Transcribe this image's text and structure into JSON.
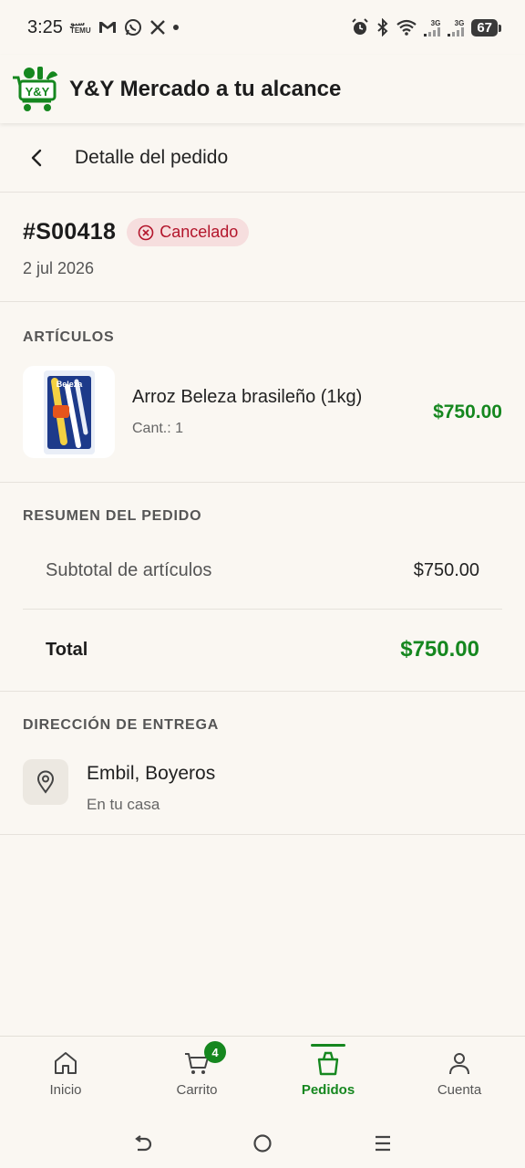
{
  "status_bar": {
    "time": "3:25",
    "mini_label_top": "ﺳﺒﻮ",
    "mini_label_bottom": "TEMU",
    "net_top": "3G",
    "net_top2": "3G",
    "battery": "67"
  },
  "app": {
    "title": "Y&Y Mercado a tu alcance",
    "logo_text": "Y&Y"
  },
  "page": {
    "title": "Detalle del pedido"
  },
  "order": {
    "id": "#S00418",
    "status": "Cancelado",
    "date": "2 jul 2026"
  },
  "items_section": {
    "label": "ARTÍCULOS",
    "items": [
      {
        "name": "Arroz Beleza brasileño (1kg)",
        "qty": "Cant.: 1",
        "price": "$750.00",
        "thumb_text": "Beleza"
      }
    ]
  },
  "summary": {
    "label": "RESUMEN DEL PEDIDO",
    "subtotal_label": "Subtotal de artículos",
    "subtotal_value": "$750.00",
    "total_label": "Total",
    "total_value": "$750.00"
  },
  "delivery": {
    "label": "DIRECCIÓN DE ENTREGA",
    "title": "Embil, Boyeros",
    "subtitle": "En tu casa"
  },
  "bottom_nav": {
    "items": [
      {
        "label": "Inicio",
        "icon": "home-icon"
      },
      {
        "label": "Carrito",
        "icon": "cart-icon",
        "badge": "4"
      },
      {
        "label": "Pedidos",
        "icon": "bag-icon",
        "active": true
      },
      {
        "label": "Cuenta",
        "icon": "user-icon"
      }
    ]
  },
  "colors": {
    "accent": "#15871f",
    "cancel_text": "#b3152b",
    "cancel_bg": "#f6dede",
    "background": "#faf7f2"
  }
}
